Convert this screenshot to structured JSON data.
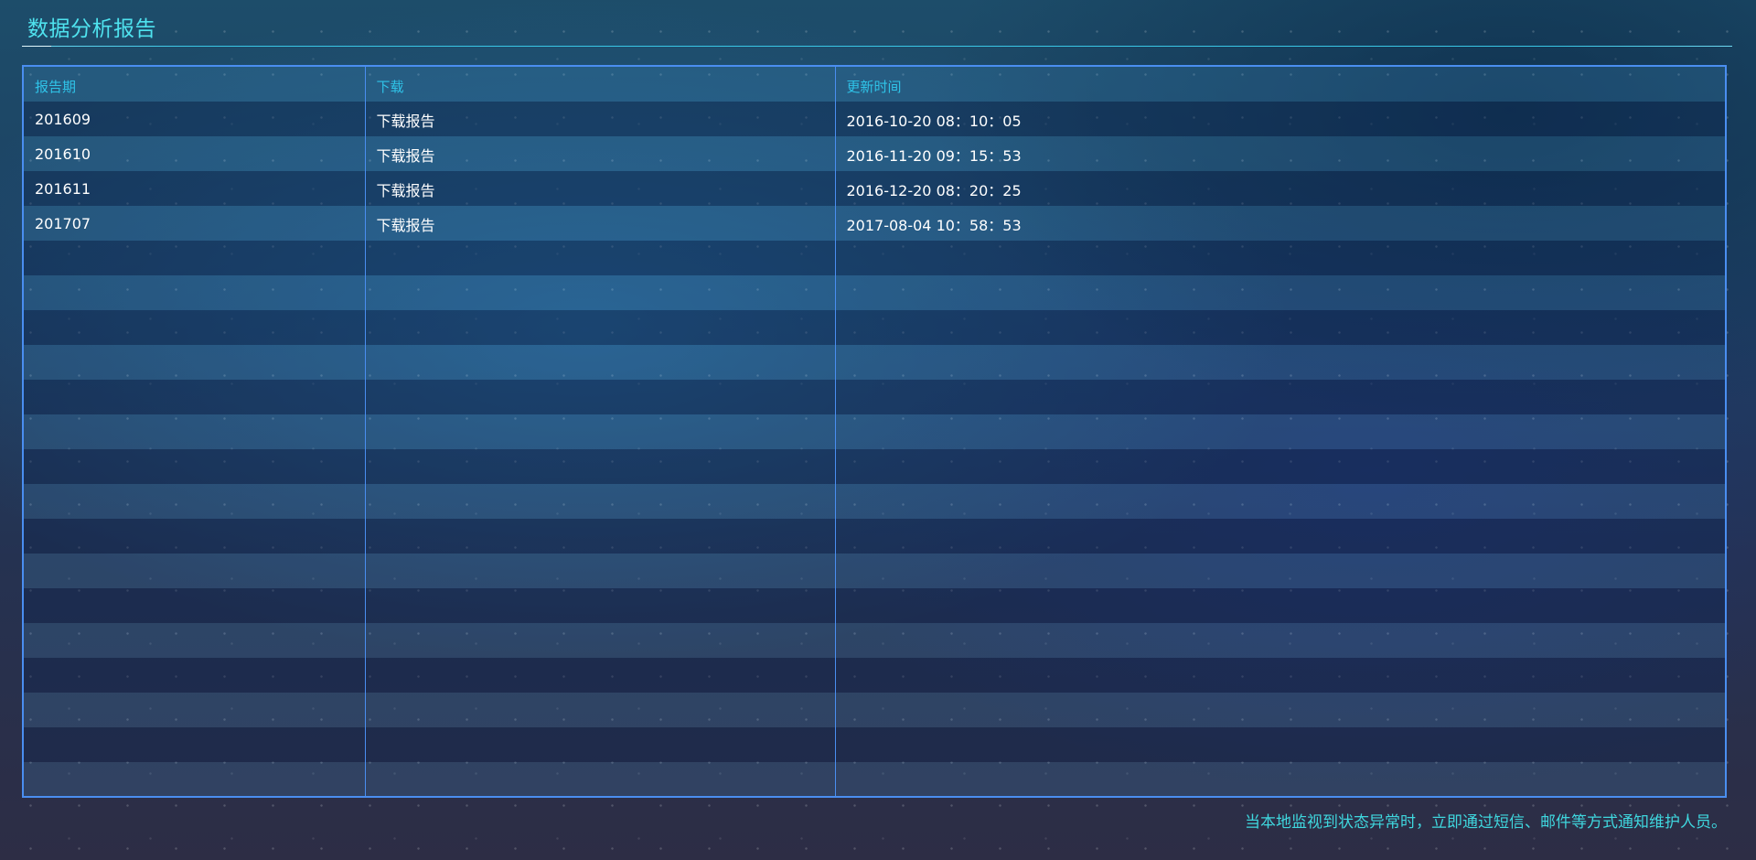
{
  "page": {
    "title": "数据分析报告"
  },
  "table": {
    "columns": [
      "报告期",
      "下载",
      "更新时间"
    ],
    "rows": [
      {
        "period": "201609",
        "download": "下载报告",
        "updated": "2016-10-20 08：10：05"
      },
      {
        "period": "201610",
        "download": "下载报告",
        "updated": "2016-11-20 09：15：53"
      },
      {
        "period": "201611",
        "download": "下载报告",
        "updated": "2016-12-20 08：20：25"
      },
      {
        "period": "201707",
        "download": "下载报告",
        "updated": "2017-08-04 10：58：53"
      }
    ],
    "empty_row_count": 16
  },
  "footer": {
    "note": "当本地监视到状态异常时，立即通过短信、邮件等方式通知维护人员。"
  },
  "colors": {
    "title": "#4fe3ef",
    "header_text": "#2fc3e8",
    "border": "#4a8ef0",
    "footer_text": "#3fd7de"
  }
}
